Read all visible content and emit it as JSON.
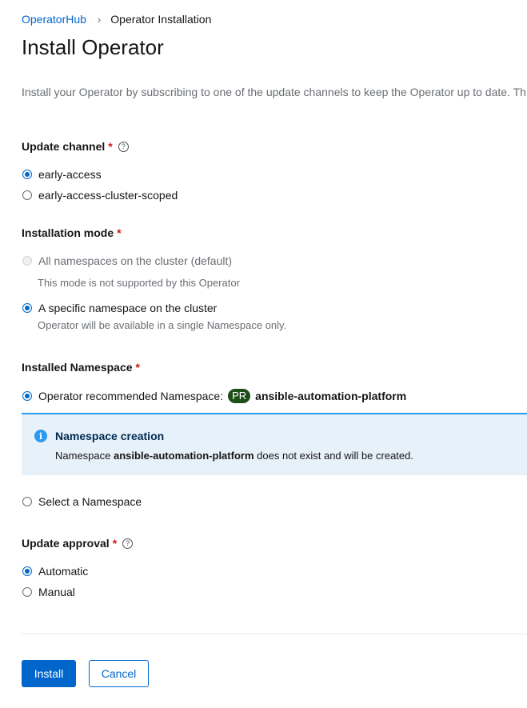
{
  "breadcrumb": {
    "parent": "OperatorHub",
    "separator": "›",
    "current": "Operator Installation"
  },
  "page_title": "Install Operator",
  "description": "Install your Operator by subscribing to one of the update channels to keep the Operator up to date. Th",
  "update_channel": {
    "label": "Update channel",
    "required_mark": "*",
    "help_icon": "?",
    "options": [
      {
        "label": "early-access",
        "selected": true
      },
      {
        "label": "early-access-cluster-scoped",
        "selected": false
      }
    ]
  },
  "installation_mode": {
    "label": "Installation mode",
    "required_mark": "*",
    "options": [
      {
        "label": "All namespaces on the cluster (default)",
        "description": "This mode is not supported by this Operator",
        "disabled": true,
        "selected": false
      },
      {
        "label": "A specific namespace on the cluster",
        "description": "Operator will be available in a single Namespace only.",
        "disabled": false,
        "selected": true
      }
    ]
  },
  "installed_namespace": {
    "label": "Installed Namespace",
    "required_mark": "*",
    "recommended_label": "Operator recommended Namespace:",
    "badge": "PR",
    "recommended_name": "ansible-automation-platform",
    "select_label": "Select a Namespace",
    "alert": {
      "icon": "i",
      "title": "Namespace creation",
      "body_prefix": "Namespace",
      "body_name": "ansible-automation-platform",
      "body_suffix": "does not exist and will be created."
    }
  },
  "update_approval": {
    "label": "Update approval",
    "required_mark": "*",
    "help_icon": "?",
    "options": [
      {
        "label": "Automatic",
        "selected": true
      },
      {
        "label": "Manual",
        "selected": false
      }
    ]
  },
  "actions": {
    "install": "Install",
    "cancel": "Cancel"
  },
  "colors": {
    "primary": "#0066cc",
    "required": "#c9190b",
    "alert_bg": "#e7f1fa",
    "alert_border": "#2b9af3",
    "badge_bg": "#1e4f18"
  }
}
